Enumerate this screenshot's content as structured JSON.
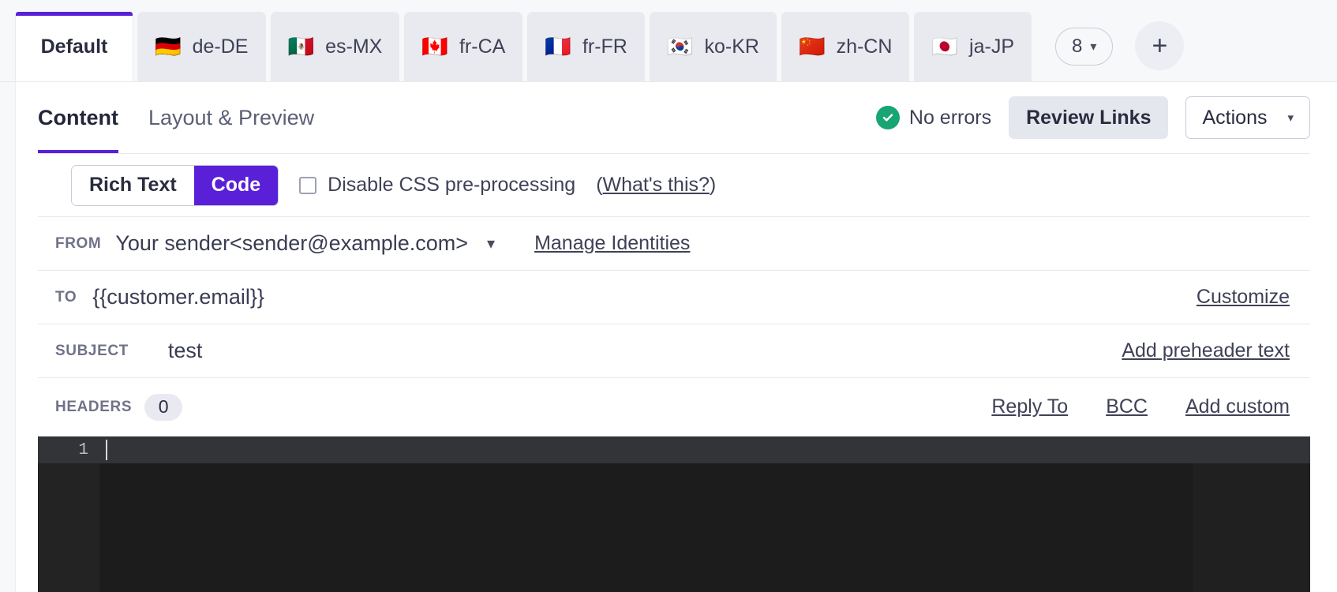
{
  "locale_tabs": [
    {
      "label": "Default",
      "flag": "",
      "active": true
    },
    {
      "label": "de-DE",
      "flag": "🇩🇪",
      "active": false
    },
    {
      "label": "es-MX",
      "flag": "🇲🇽",
      "active": false
    },
    {
      "label": "fr-CA",
      "flag": "🇨🇦",
      "active": false
    },
    {
      "label": "fr-FR",
      "flag": "🇫🇷",
      "active": false
    },
    {
      "label": "ko-KR",
      "flag": "🇰🇷",
      "active": false
    },
    {
      "label": "zh-CN",
      "flag": "🇨🇳",
      "active": false
    },
    {
      "label": "ja-JP",
      "flag": "🇯🇵",
      "active": false
    }
  ],
  "tab_count": {
    "value": "8",
    "chevron": "chevron-down-icon"
  },
  "add_tab": {
    "glyph": "+"
  },
  "subtabs": [
    {
      "label": "Content",
      "active": true
    },
    {
      "label": "Layout & Preview",
      "active": false
    }
  ],
  "status": {
    "icon": "check-circle-icon",
    "text": "No errors",
    "color": "#17a673"
  },
  "buttons": {
    "review_links": "Review Links",
    "actions": "Actions",
    "actions_caret": "▾"
  },
  "toolbar": {
    "segment": [
      {
        "label": "Rich Text",
        "active": false
      },
      {
        "label": "Code",
        "active": true
      }
    ],
    "checkbox_label": "Disable CSS pre-processing",
    "checkbox_checked": false,
    "whats_this": "What's this?"
  },
  "fields": {
    "from": {
      "label": "FROM",
      "value": "Your sender<sender@example.com>",
      "chevron": "chevron-down-icon",
      "link": "Manage Identities"
    },
    "to": {
      "label": "TO",
      "value": "{{customer.email}}",
      "link": "Customize"
    },
    "subject": {
      "label": "SUBJECT",
      "value": "test",
      "link": "Add preheader text"
    },
    "headers": {
      "label": "HEADERS",
      "count": "0",
      "links": [
        "Reply To",
        "BCC",
        "Add custom"
      ]
    }
  },
  "editor": {
    "line_numbers": [
      "1"
    ],
    "content": ""
  },
  "colors": {
    "accent": "#5a20d8",
    "success": "#17a673",
    "tab_inactive_bg": "#e9eaef",
    "editor_bg": "#1e1e1e"
  }
}
